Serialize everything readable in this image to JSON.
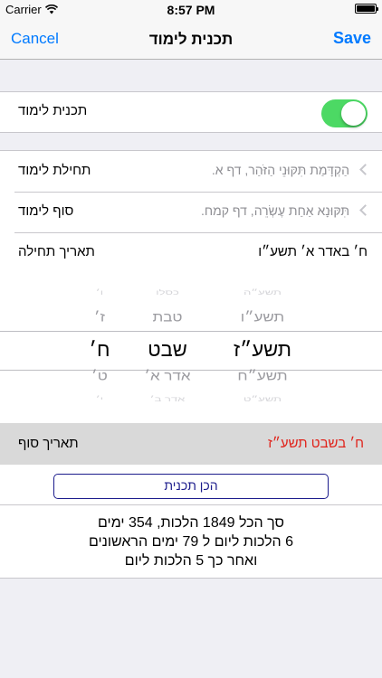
{
  "status_bar": {
    "carrier": "Carrier",
    "time": "8:57 PM"
  },
  "nav": {
    "cancel_label": "Cancel",
    "title": "תכנית לימוד",
    "save_label": "Save"
  },
  "plan_toggle": {
    "label": "תכנית לימוד",
    "on": true
  },
  "rows": {
    "start": {
      "label": "תחילת לימוד",
      "value": "הַקְדָּמַת תִּקּוּנֵי הַזֹּהַר, דף א."
    },
    "end": {
      "label": "סוף לימוד",
      "value": "תִּקּוּנָא אַחַת עֶשְׂרֵה, דף קמח."
    },
    "start_date": {
      "label": "תאריך תחילה",
      "value": "ח׳ באדר א׳ תשע״ו"
    }
  },
  "picker": {
    "years": [
      "תשע״ה",
      "תשע״ו",
      "תשע״ז",
      "תשע״ח",
      "תשע״ט"
    ],
    "months": [
      "כסלו",
      "טבת",
      "שבט",
      "אדר א׳",
      "אדר ב׳"
    ],
    "days": [
      "ו׳",
      "ז׳",
      "ח׳",
      "ט׳",
      "י׳"
    ]
  },
  "end_date": {
    "label": "תאריך סוף",
    "value": "ח׳ בשבט תשע״ז",
    "value_color": "#e0231b"
  },
  "prepare_button": {
    "label": "הכן תכנית"
  },
  "summary": {
    "line1": "סך הכל 1849 הלכות, 354 ימים",
    "line2": "6 הלכות ליום  ל 79 ימים הראשונים",
    "line3": "ואחר כך 5 הלכות ליום"
  },
  "colors": {
    "accent": "#007aff",
    "toggle_on": "#4cd964",
    "button_border": "#1c1c8c"
  }
}
